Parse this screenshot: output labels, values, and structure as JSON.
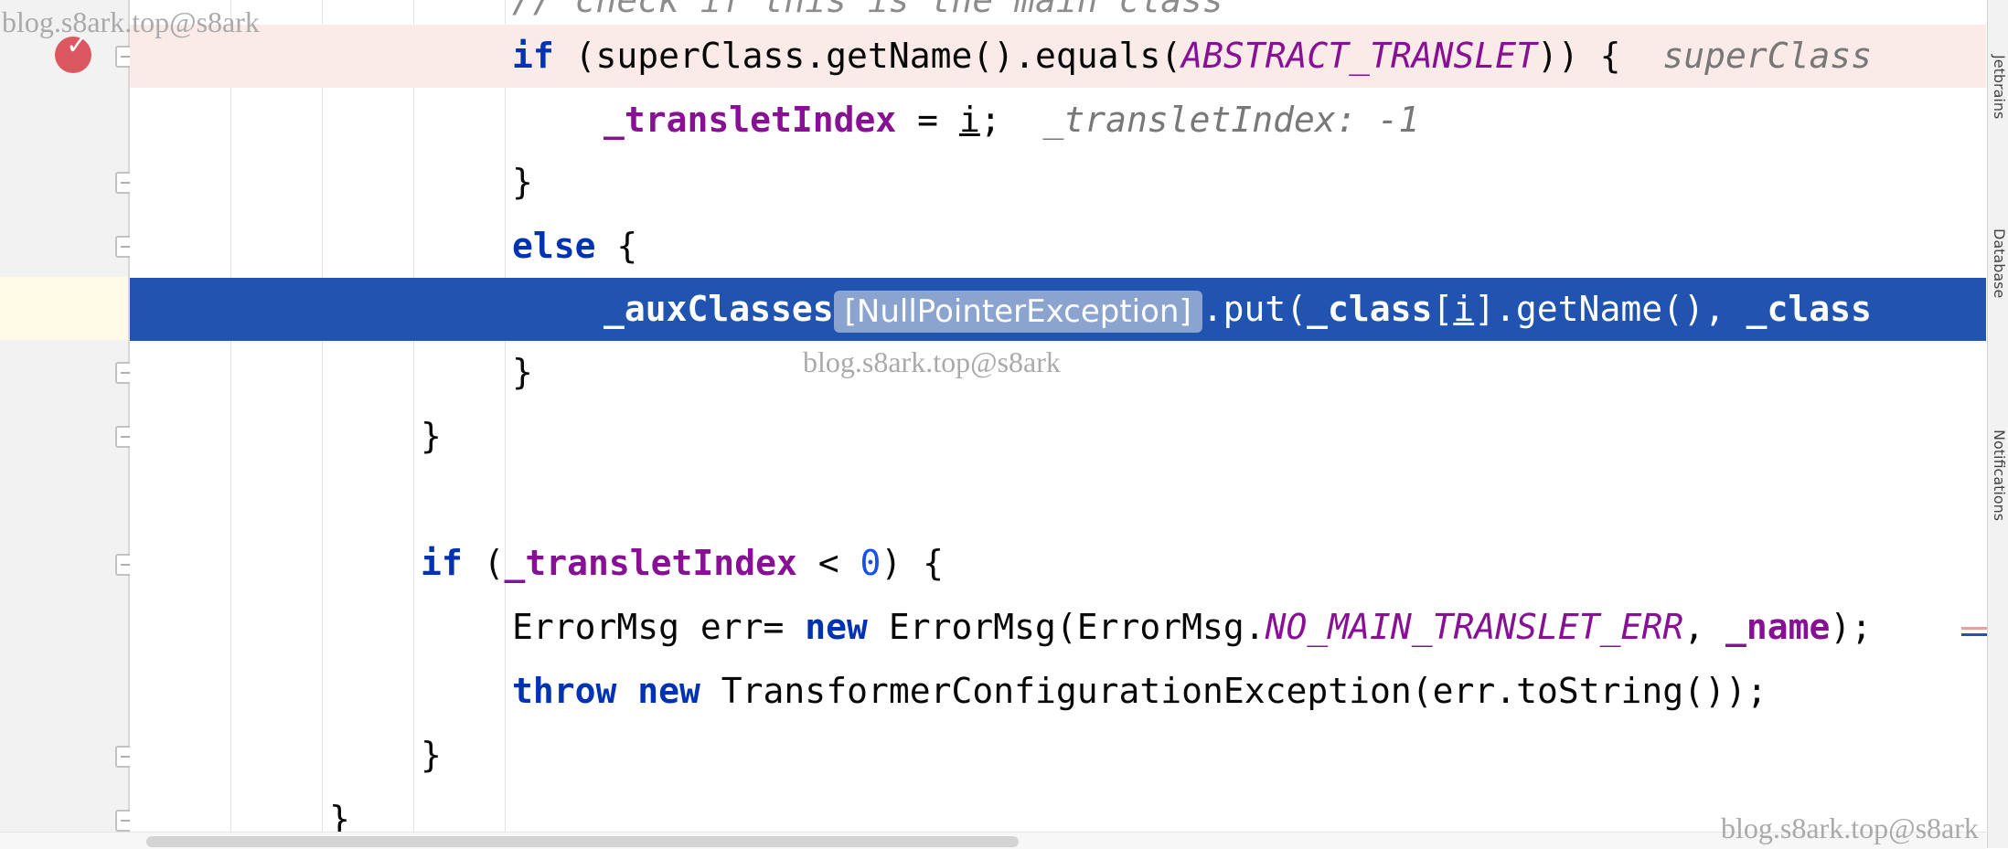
{
  "watermark": {
    "text": "blog.s8ark.top@s8ark"
  },
  "right_panel": {
    "tabs": [
      "Jetbrains",
      "Database",
      "Notifications"
    ]
  },
  "colors": {
    "keyword": "#0033b3",
    "field": "#871094",
    "number": "#1750eb",
    "exec_line": "#2154b0",
    "breakpoint": "#db5860"
  },
  "code": {
    "comment": "// check if this is the main class",
    "if1": {
      "kw": "if",
      "pre": " (superClass.getName().equals(",
      "const": "ABSTRACT_TRANSLET",
      "post": ")) {  ",
      "hint": "superClass"
    },
    "assign": {
      "field": "_transletIndex",
      "op": " = ",
      "var": "i",
      "end": ";  ",
      "hint": "_transletIndex: -1"
    },
    "brace_close": "}",
    "else": {
      "kw": "else",
      "post": " {"
    },
    "exec": {
      "field": "_auxClasses",
      "badge": "[NullPointerException]",
      "mid": ".put(",
      "field2": "_class",
      "bo": "[",
      "var": "i",
      "mid2": "].getName(), ",
      "field3": "_class"
    },
    "if2": {
      "kw": "if",
      "pre": " (",
      "field": "_transletIndex",
      "mid": " < ",
      "num": "0",
      "post": ") {"
    },
    "err": {
      "pre": "ErrorMsg err= ",
      "kw": "new",
      "mid": " ErrorMsg(ErrorMsg.",
      "const": "NO_MAIN_TRANSLET_ERR",
      "sep": ", ",
      "field": "_name",
      "end": ");"
    },
    "throw": {
      "kw": "throw",
      "sp": " ",
      "kw2": "new",
      "post": " TransformerConfigurationException(err.toString());"
    }
  }
}
